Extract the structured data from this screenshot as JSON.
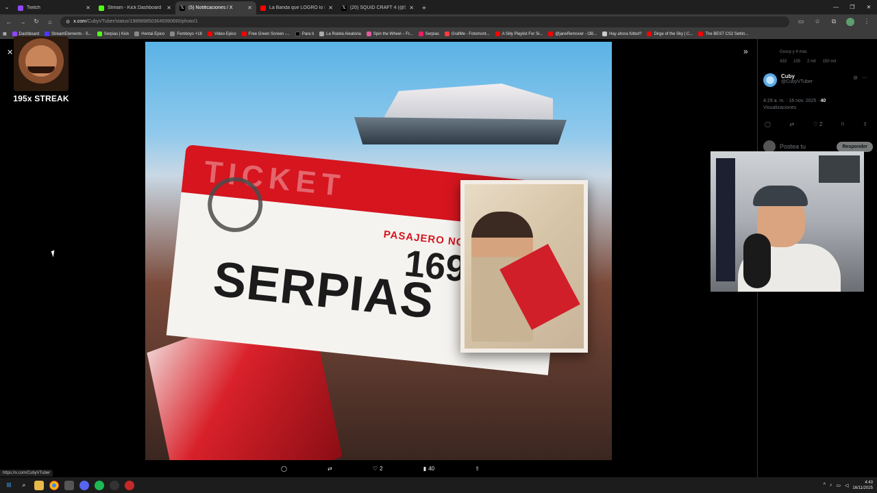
{
  "tabs": [
    {
      "label": "Twitch",
      "color": "#9146ff"
    },
    {
      "label": "Stream - Kick Dashboard",
      "color": "#53fc18"
    },
    {
      "label": "(5) Notificaciones / X",
      "color": "#ffffff",
      "active": true
    },
    {
      "label": "La Banda que LOGRÓ lo IMPOS",
      "color": "#ff0000"
    },
    {
      "label": "(20) SQUID CRAFT 4 (@SquidC",
      "color": "#ffffff"
    }
  ],
  "address": {
    "host": "x.com",
    "path": "/CubyVTuber/status/1989898503649390690/photo/1"
  },
  "bookmarks": [
    {
      "label": "Dashboard",
      "color": "#9146ff"
    },
    {
      "label": "StreamElements - S...",
      "color": "#4b3bff"
    },
    {
      "label": "Serpias | Kick",
      "color": "#53fc18"
    },
    {
      "label": "Hentai Epico",
      "color": "#cccccc"
    },
    {
      "label": "Femboys +18",
      "color": "#cccccc"
    },
    {
      "label": "Video Epico",
      "color": "#ff0000"
    },
    {
      "label": "Free Green Screen -...",
      "color": "#ff0000"
    },
    {
      "label": "Para ti",
      "color": "#ffffff"
    },
    {
      "label": "La Ruleta Aleatoria",
      "color": "#aaaaaa"
    },
    {
      "label": "Spin the Wheel – Fr...",
      "color": "#e05aa0"
    },
    {
      "label": "Serpias",
      "color": "#e91e63"
    },
    {
      "label": "GrafMe - Fotomont...",
      "color": "#ff3b3b"
    },
    {
      "label": "A Silly Playlist For Si...",
      "color": "#ff0000"
    },
    {
      "label": "@janeRemover - OB...",
      "color": "#ff0000"
    },
    {
      "label": "Hay ahora fútbol?",
      "color": "#cccccc"
    },
    {
      "label": "Dirge of the Sky | C...",
      "color": "#ff0000"
    },
    {
      "label": "The BEST CS2 Settin...",
      "color": "#ff0000"
    }
  ],
  "overlay": {
    "streak_label": "195x STREAK"
  },
  "ticket": {
    "word": "TICKET",
    "passenger_label": "PASAJERO NO.",
    "number": "169",
    "name": "SERPIAS"
  },
  "photo_actions": {
    "likes": "2",
    "views": "40"
  },
  "panel": {
    "prev_time": "Gussy y 4 más",
    "prev_stats": {
      "replies": "433",
      "reposts": "155",
      "likes": "2 mil",
      "views": "150 mil"
    },
    "author_name": "Cuby",
    "author_handle": "@CubyVTuber",
    "timestamp": "4:29 a. m. · 16 nov. 2025 · ",
    "views_count": "40",
    "views_label": "Visualizaciones",
    "likes": "2",
    "reply_placeholder": "Postea tu",
    "reply_button": "Responder"
  },
  "status_url": "https://x.com/CubyVTuber",
  "clock": {
    "time": "4:43",
    "date": "16/11/2025"
  }
}
